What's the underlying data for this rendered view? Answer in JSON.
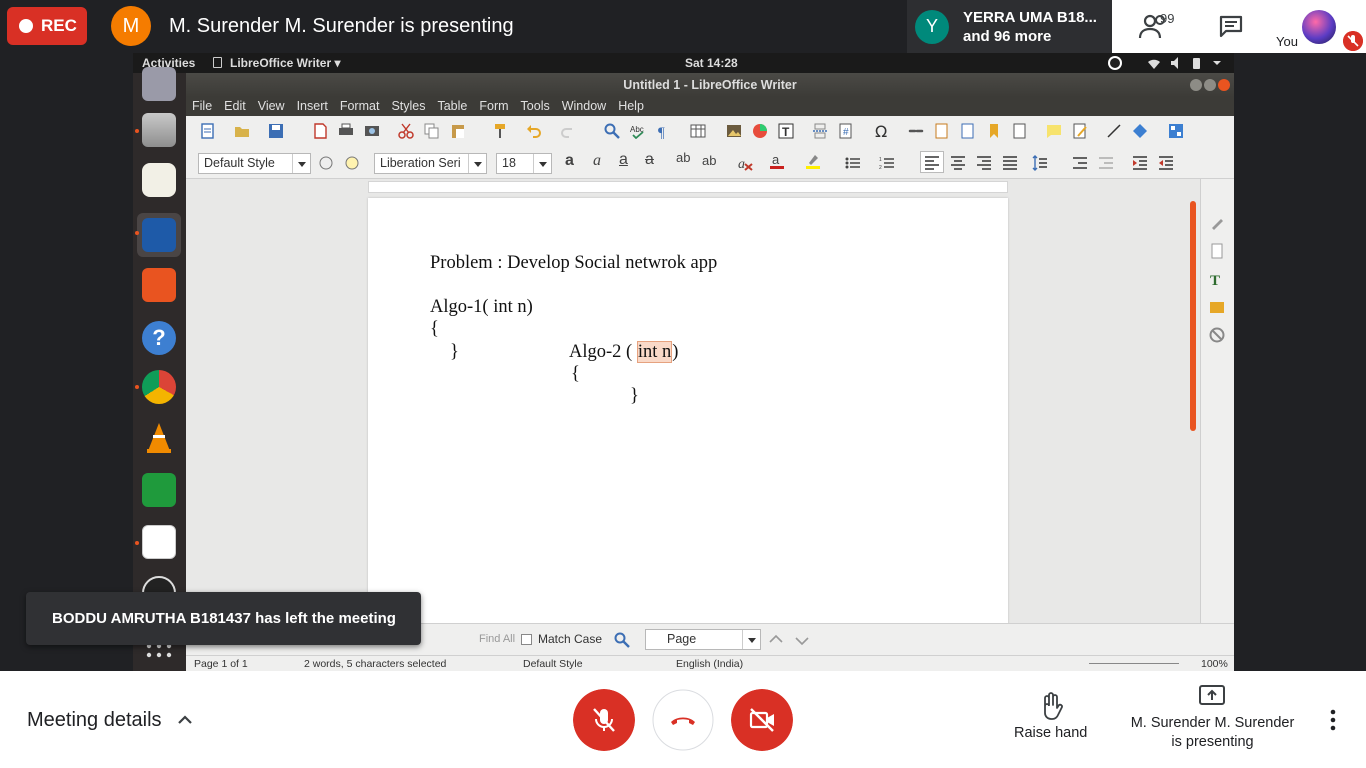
{
  "meet": {
    "rec_label": "REC",
    "presenter_initial": "M",
    "presenting_title": "M. Surender M. Surender is presenting",
    "participant_initial": "Y",
    "participant_name": "YERRA UMA B18...",
    "participant_more": "and 96 more",
    "people_count": "99",
    "you_label": "You",
    "toast": "BODDU AMRUTHA B181437 has left the meeting",
    "meeting_details": "Meeting details",
    "raise_hand": "Raise hand",
    "presenting_line1": "M. Surender M. Surender",
    "presenting_line2": "is presenting",
    "colors": {
      "rec": "#d93025",
      "presenter_avatar": "#f57c00",
      "participant_avatar": "#00897b",
      "end_call": "#d93025"
    }
  },
  "ubuntu": {
    "activities": "Activities",
    "app_menu": "LibreOffice Writer ▾",
    "clock": "Sat 14:28",
    "window_title": "Untitled 1 - LibreOffice Writer"
  },
  "writer": {
    "menu": [
      "File",
      "Edit",
      "View",
      "Insert",
      "Format",
      "Styles",
      "Table",
      "Form",
      "Tools",
      "Window",
      "Help"
    ],
    "paragraph_style": "Default Style",
    "font_name": "Liberation Seri",
    "font_size": "18",
    "document": {
      "line1": "Problem : Develop Social netwrok app",
      "line2": "Algo-1( int n)",
      "line3": "{",
      "line4": "}",
      "line5_prefix": "Algo-2 (",
      "line5_selected": "int n",
      "line5_suffix": ")",
      "line6": "{",
      "line7": "}"
    },
    "find": {
      "find_all": "Find All",
      "match_case": "Match Case",
      "search_type": "Page"
    },
    "status": {
      "page": "Page 1 of 1",
      "words": "2 words, 5 characters selected",
      "style": "Default Style",
      "language": "English (India)",
      "zoom": "100%"
    }
  }
}
